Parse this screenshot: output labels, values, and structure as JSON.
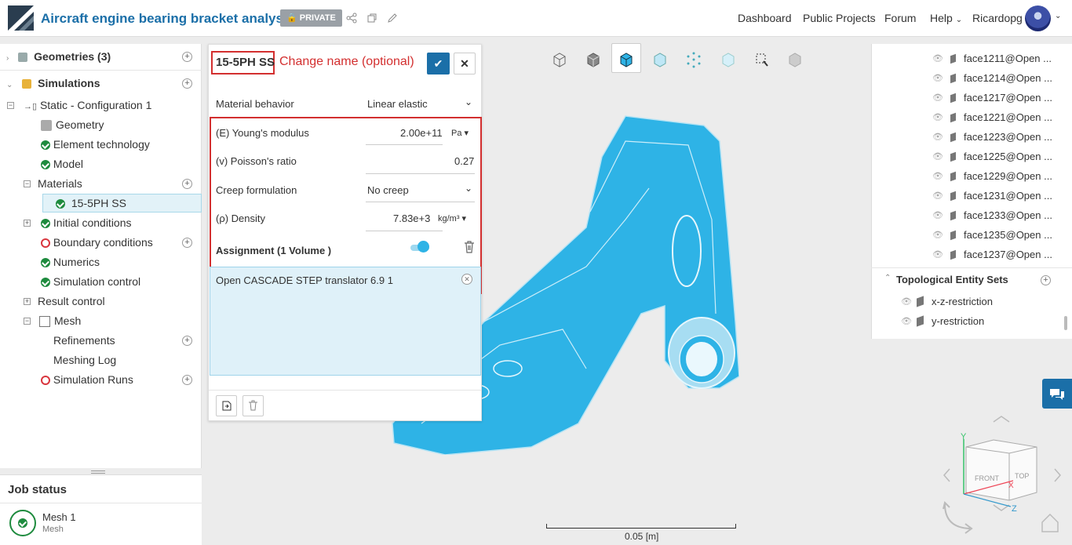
{
  "header": {
    "title": "Aircraft engine bearing bracket analysis",
    "badge": "PRIVATE",
    "nav": [
      "Dashboard",
      "Public Projects",
      "Forum",
      "Help"
    ],
    "user": "Ricardopg"
  },
  "tree": {
    "geometries": "Geometries (3)",
    "simulations": "Simulations",
    "config": "Static - Configuration 1",
    "items": {
      "geometry": "Geometry",
      "element": "Element technology",
      "model": "Model",
      "materials": "Materials",
      "material1": "15-5PH SS",
      "initial": "Initial conditions",
      "boundary": "Boundary conditions",
      "numerics": "Numerics",
      "simcontrol": "Simulation control",
      "result": "Result control",
      "mesh": "Mesh",
      "refinements": "Refinements",
      "meshlog": "Meshing Log",
      "runs": "Simulation Runs"
    }
  },
  "job": {
    "title": "Job status",
    "name": "Mesh 1",
    "type": "Mesh"
  },
  "dialog": {
    "name": "15-5PH SS",
    "hint": "Change name (optional)",
    "behavior_label": "Material behavior",
    "behavior_value": "Linear elastic",
    "young_label": "(E) Young's modulus",
    "young_value": "2.00e+11",
    "young_unit": "Pa",
    "poisson_label": "(v) Poisson's ratio",
    "poisson_value": "0.27",
    "creep_label": "Creep formulation",
    "creep_value": "No creep",
    "density_label": "(ρ) Density",
    "density_value": "7.83e+3",
    "density_unit": "kg/m³",
    "assignment": "Assignment (1 Volume )",
    "assigned_item": "Open CASCADE STEP translator 6.9 1"
  },
  "right": {
    "faces": [
      "face1211@Open ...",
      "face1214@Open ...",
      "face1217@Open ...",
      "face1221@Open ...",
      "face1223@Open ...",
      "face1225@Open ...",
      "face1229@Open ...",
      "face1231@Open ...",
      "face1233@Open ...",
      "face1235@Open ...",
      "face1237@Open ..."
    ],
    "sets_title": "Topological Entity Sets",
    "sets": [
      "x-z-restriction",
      "y-restriction"
    ]
  },
  "viewer": {
    "scale_label": "0.05 [m]",
    "cube_front": "FRONT",
    "cube_top": "TOP",
    "axis_x": "X",
    "axis_y": "Y",
    "axis_z": "Z"
  },
  "colors": {
    "accent": "#1b6fa8",
    "part": "#2eb3e6",
    "ok": "#1e8b3e",
    "warn": "#d9363e"
  }
}
